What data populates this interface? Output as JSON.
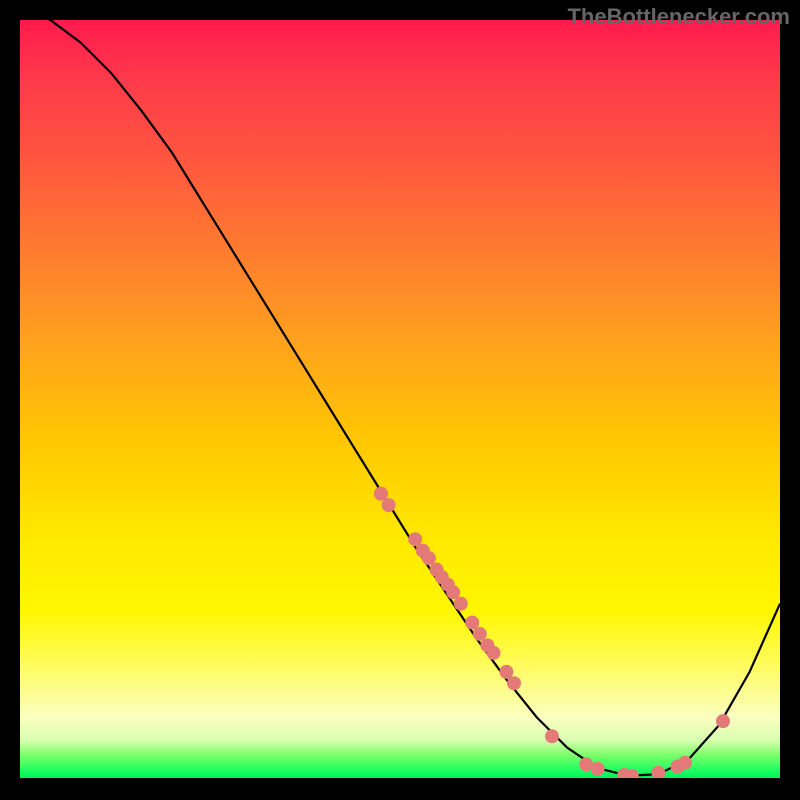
{
  "watermark": "TheBottlenecker.com",
  "chart_data": {
    "type": "line",
    "title": "",
    "xlabel": "",
    "ylabel": "",
    "xlim": [
      0,
      100
    ],
    "ylim": [
      0,
      100
    ],
    "curve": {
      "x": [
        0,
        4,
        8,
        12,
        16,
        20,
        24,
        28,
        32,
        36,
        40,
        44,
        48,
        52,
        56,
        60,
        64,
        68,
        72,
        76,
        80,
        84,
        88,
        92,
        96,
        100
      ],
      "y": [
        102,
        100,
        97,
        93,
        88,
        82.5,
        76,
        69.5,
        63,
        56.5,
        50,
        43.5,
        37,
        30.5,
        24.5,
        18.5,
        13,
        8,
        4,
        1.3,
        0.3,
        0.5,
        2.5,
        7,
        14,
        23
      ]
    },
    "scatter_points": [
      {
        "x": 47.5,
        "y": 37.5
      },
      {
        "x": 48.5,
        "y": 36.0
      },
      {
        "x": 52.0,
        "y": 31.5
      },
      {
        "x": 53.0,
        "y": 30.0
      },
      {
        "x": 53.8,
        "y": 29.0
      },
      {
        "x": 54.8,
        "y": 27.5
      },
      {
        "x": 55.5,
        "y": 26.5
      },
      {
        "x": 56.3,
        "y": 25.5
      },
      {
        "x": 57.0,
        "y": 24.5
      },
      {
        "x": 58.0,
        "y": 23.0
      },
      {
        "x": 59.5,
        "y": 20.5
      },
      {
        "x": 60.5,
        "y": 19.0
      },
      {
        "x": 61.5,
        "y": 17.5
      },
      {
        "x": 62.3,
        "y": 16.5
      },
      {
        "x": 64.0,
        "y": 14.0
      },
      {
        "x": 65.0,
        "y": 12.5
      },
      {
        "x": 70.0,
        "y": 5.5
      },
      {
        "x": 74.5,
        "y": 1.8
      },
      {
        "x": 76.0,
        "y": 1.2
      },
      {
        "x": 79.5,
        "y": 0.4
      },
      {
        "x": 80.5,
        "y": 0.3
      },
      {
        "x": 84.0,
        "y": 0.7
      },
      {
        "x": 86.5,
        "y": 1.5
      },
      {
        "x": 87.5,
        "y": 2.0
      },
      {
        "x": 92.5,
        "y": 7.5
      }
    ],
    "colors": {
      "curve": "#000000",
      "points": "#e47a78",
      "gradient_top": "#ff1a4d",
      "gradient_bottom": "#00f060"
    }
  }
}
